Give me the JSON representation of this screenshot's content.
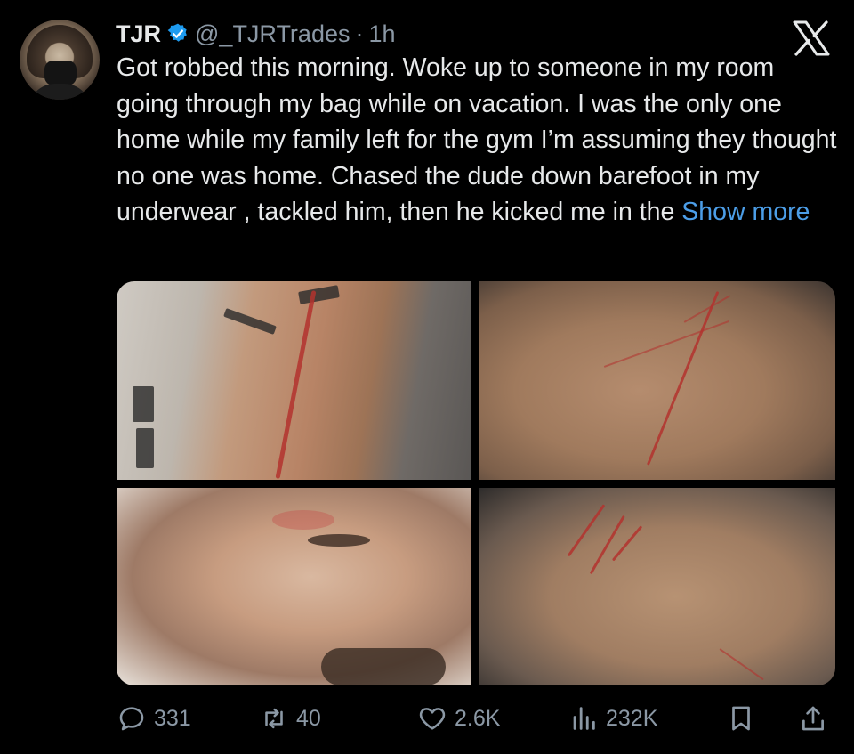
{
  "tweet": {
    "author_name": "TJR",
    "handle": "@_TJRTrades",
    "separator": "·",
    "time": "1h",
    "text": "Got robbed this morning. Woke up to someone in my room going through my bag while on vacation. I was the only one home while my family left for the gym I’m assuming they thought no one was home. Chased the dude down barefoot in my underwear , tackled him, then he kicked me in the",
    "show_more": "Show more"
  },
  "icons": {
    "verified": "verified-badge-icon",
    "logo": "x-logo-icon",
    "reply": "reply-icon",
    "retweet": "retweet-icon",
    "like": "like-icon",
    "views": "views-icon",
    "bookmark": "bookmark-icon",
    "share": "share-icon"
  },
  "media": {
    "photos": [
      "forearm-cut-photo",
      "arm-scratches-photo",
      "face-bruise-photo",
      "knee-scratches-photo"
    ]
  },
  "actions": {
    "replies": "331",
    "retweets": "40",
    "likes": "2.6K",
    "views": "232K"
  },
  "colors": {
    "background": "#000000",
    "text": "#e7e9ea",
    "secondary": "#8b98a5",
    "link": "#4c9ee8",
    "verified": "#1d9bf0"
  }
}
